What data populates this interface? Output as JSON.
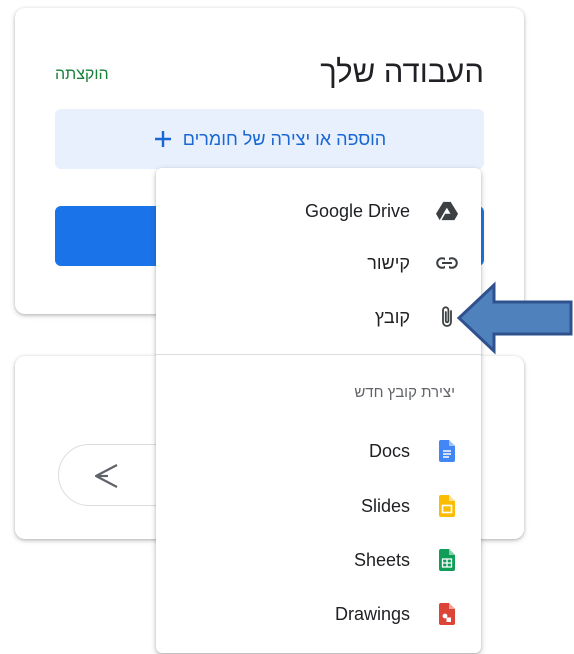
{
  "work_card": {
    "title": "העבודה שלך",
    "status": "הוקצתה",
    "add_button_label": "הוספה או יצירה של חומרים"
  },
  "menu": {
    "items": [
      {
        "label": "Google Drive",
        "icon": "google-drive-icon"
      },
      {
        "label": "קישור",
        "icon": "link-icon"
      },
      {
        "label": "קובץ",
        "icon": "paperclip-icon"
      }
    ],
    "create_section_title": "יצירת קובץ חדש",
    "create_items": [
      {
        "label": "Docs",
        "icon": "docs-icon",
        "color": "#4285f4"
      },
      {
        "label": "Slides",
        "icon": "slides-icon",
        "color": "#fbbc04"
      },
      {
        "label": "Sheets",
        "icon": "sheets-icon",
        "color": "#0f9d58"
      },
      {
        "label": "Drawings",
        "icon": "drawings-icon",
        "color": "#db4437"
      }
    ]
  },
  "colors": {
    "accent": "#1a73e8",
    "accent_light": "#e8f0fe",
    "assigned_green": "#188038",
    "arrow_fill": "#4f81bd",
    "arrow_stroke": "#2f528f"
  }
}
